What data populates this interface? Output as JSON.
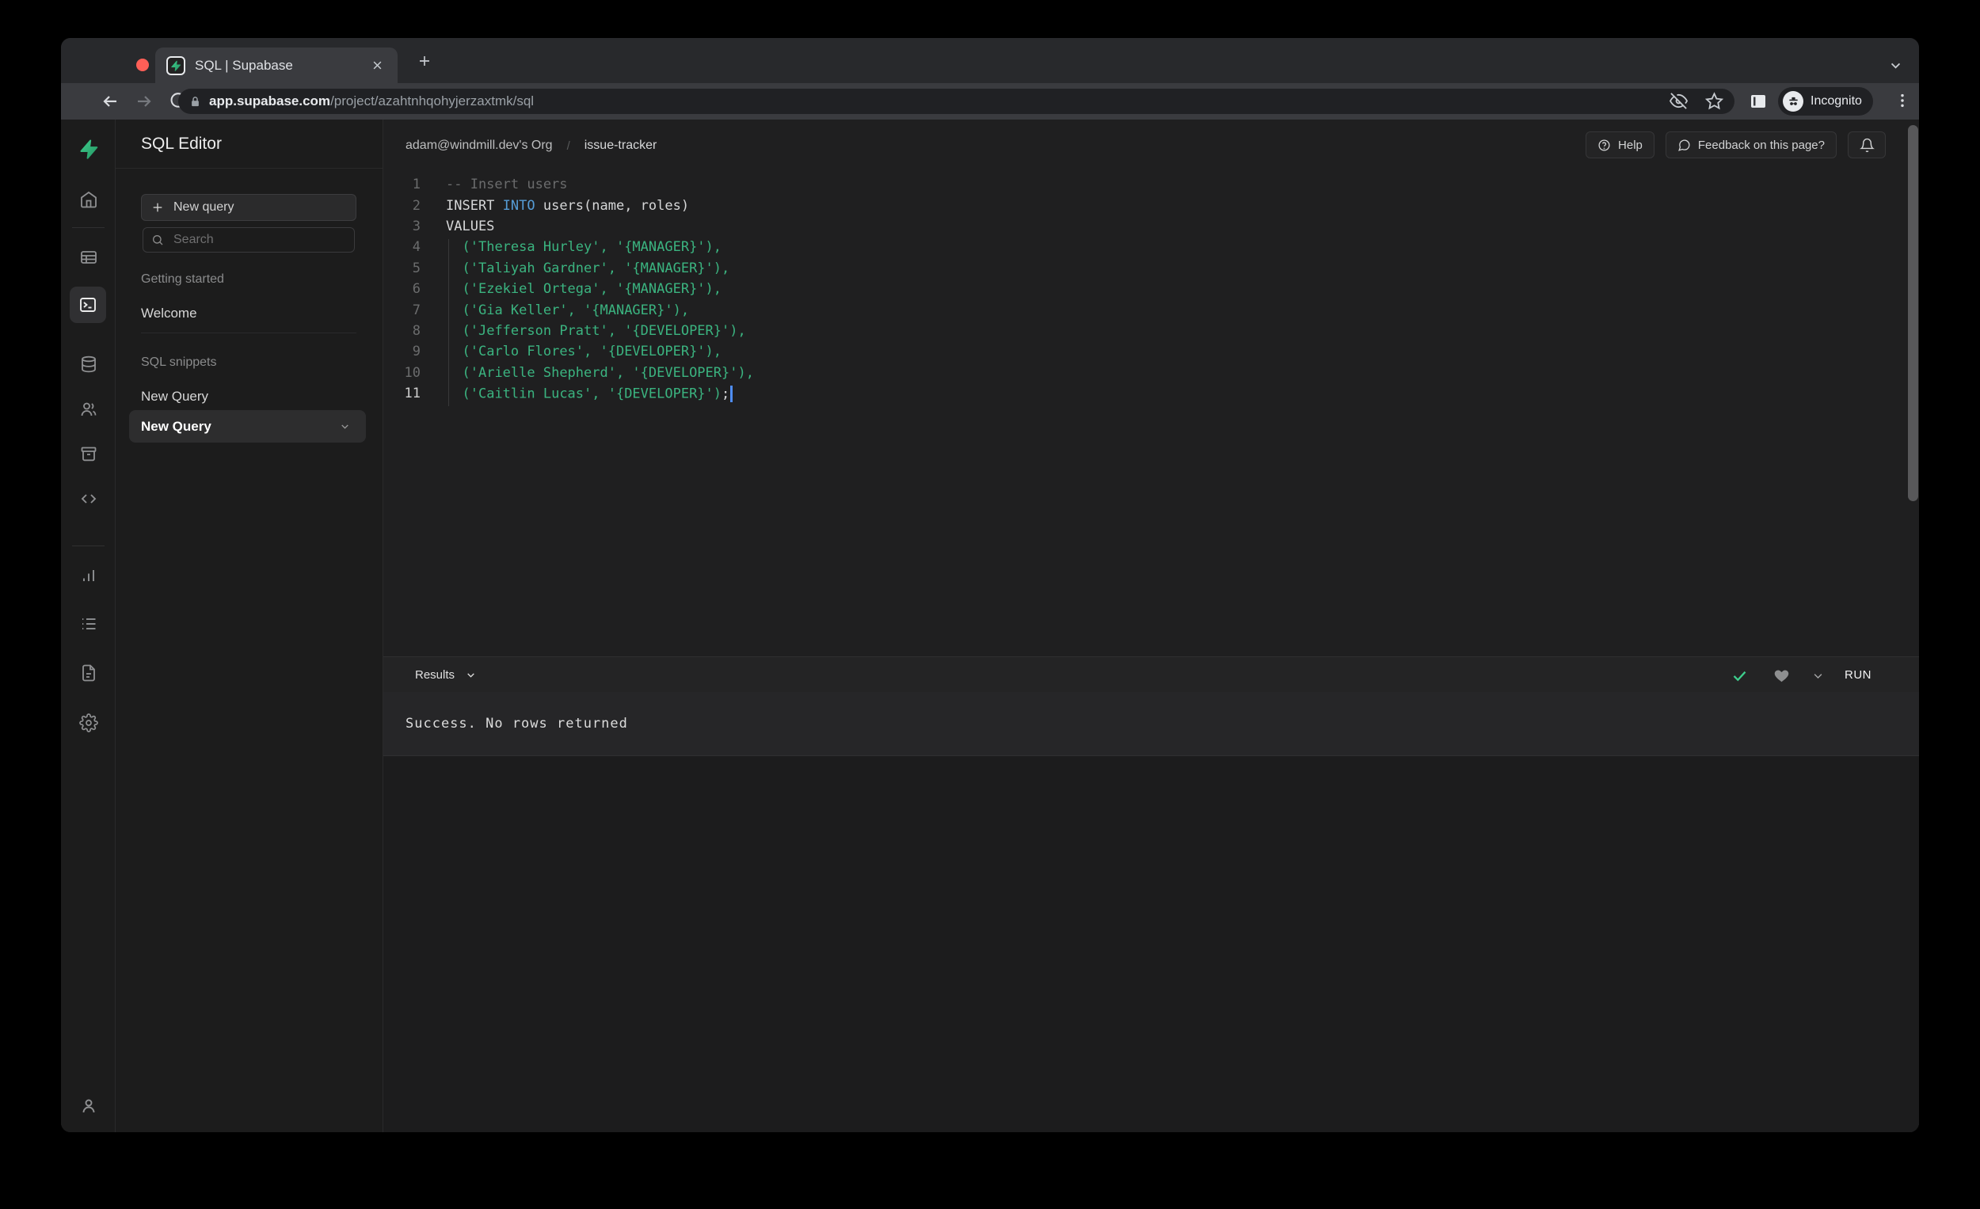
{
  "browser": {
    "tab_title": "SQL | Supabase",
    "url_host": "app.supabase.com",
    "url_path": "/project/azahtnhqohyjerzaxtmk/sql",
    "incognito_label": "Incognito"
  },
  "header": {
    "breadcrumb_org": "adam@windmill.dev's Org",
    "breadcrumb_sep": "/",
    "breadcrumb_project": "issue-tracker",
    "help_label": "Help",
    "feedback_label": "Feedback on this page?"
  },
  "sidebar": {
    "title": "SQL Editor",
    "new_query_button": "New query",
    "search_placeholder": "Search",
    "section_getting_started": "Getting started",
    "item_welcome": "Welcome",
    "section_sql_snippets": "SQL snippets",
    "item_new_query": "New Query",
    "item_new_query_selected": "New Query"
  },
  "rail_icons": [
    "supabase-logo",
    "home",
    "table-editor",
    "sql-editor (selected)",
    "database",
    "auth-users",
    "storage",
    "edge-functions",
    "reports",
    "logs",
    "docs",
    "settings",
    "account"
  ],
  "editor": {
    "lines": [
      {
        "num": "1",
        "comment": "-- Insert users"
      },
      {
        "num": "2",
        "pre": "INSERT ",
        "keyword": "INTO",
        "post": " users(name, roles)"
      },
      {
        "num": "3",
        "plain": "VALUES"
      },
      {
        "num": "4",
        "string": "('Theresa Hurley', '{MANAGER}'),"
      },
      {
        "num": "5",
        "string": "('Taliyah Gardner', '{MANAGER}'),"
      },
      {
        "num": "6",
        "string": "('Ezekiel Ortega', '{MANAGER}'),"
      },
      {
        "num": "7",
        "string": "('Gia Keller', '{MANAGER}'),"
      },
      {
        "num": "8",
        "string": "('Jefferson Pratt', '{DEVELOPER}'),"
      },
      {
        "num": "9",
        "string": "('Carlo Flores', '{DEVELOPER}'),"
      },
      {
        "num": "10",
        "string": "('Arielle Shepherd', '{DEVELOPER}'),"
      },
      {
        "num": "11",
        "string": "('Caitlin Lucas', '{DEVELOPER}')",
        "semi": ";"
      }
    ]
  },
  "results": {
    "dropdown_label": "Results",
    "run_label": "RUN",
    "message": "Success. No rows returned"
  },
  "colors": {
    "accent_green": "#3ecf8e",
    "keyword_blue": "#569cd6",
    "string_green": "#3bb480",
    "comment_gray": "#6a6b6c",
    "traffic_red": "#ff5f57",
    "traffic_yellow": "#febc2e",
    "traffic_green": "#28c840",
    "app_bg": "#1f1f20",
    "sidebar_bg": "#1c1c1c"
  }
}
